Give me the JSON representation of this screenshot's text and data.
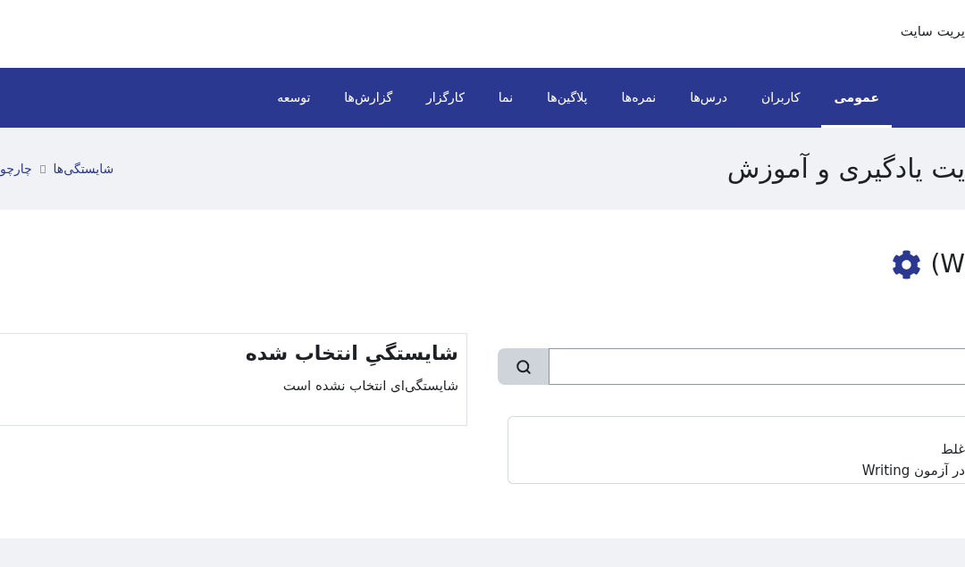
{
  "top_bar": {
    "title": "یریت سایت"
  },
  "nav": [
    {
      "label": "عمومی",
      "selected": true
    },
    {
      "label": "کاربران",
      "selected": false
    },
    {
      "label": "درس‌ها",
      "selected": false
    },
    {
      "label": "نمره‌ها",
      "selected": false
    },
    {
      "label": "پلاگین‌ها",
      "selected": false
    },
    {
      "label": "نما",
      "selected": false
    },
    {
      "label": "کارگزار",
      "selected": false
    },
    {
      "label": "گزارش‌ها",
      "selected": false
    },
    {
      "label": "توسعه",
      "selected": false
    }
  ],
  "header": {
    "title": "یت یادگیری و آموزش",
    "breadcrumb": [
      "شایستگی‌ها",
      "چارچو"
    ]
  },
  "page_heading": {
    "title": "(W"
  },
  "selected_competency": {
    "title": "شایستگیِ انتخاب شده",
    "message": "شایستگی‌ای انتخاب نشده است"
  },
  "competency_tree": {
    "lines": [
      "غلط",
      "در آزمون Writing"
    ]
  }
}
